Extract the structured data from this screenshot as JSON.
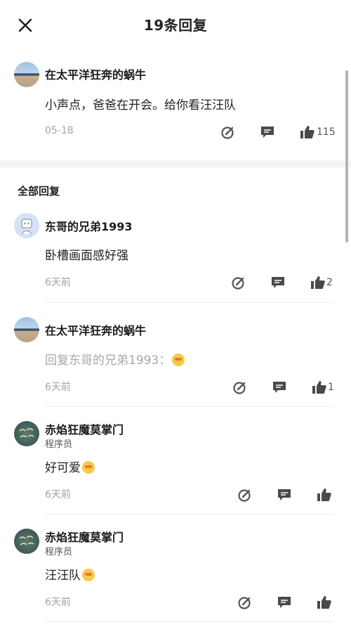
{
  "header": {
    "title": "19条回复"
  },
  "main_comment": {
    "username": "在太平洋狂奔的蜗牛",
    "content": "小声点，爸爸在开会。给你看汪汪队",
    "date": "05-18",
    "likes": "115"
  },
  "section": {
    "title": "全部回复"
  },
  "replies": [
    {
      "username": "东哥的兄弟1993",
      "role": "",
      "content": "卧槽画面感好强",
      "date": "6天前",
      "likes": "2",
      "avatar": "robot-avatar"
    },
    {
      "username": "在太平洋狂奔的蜗牛",
      "role": "",
      "content": "回复东哥的兄弟1993：",
      "date": "6天前",
      "likes": "1",
      "avatar": "beach-avatar"
    },
    {
      "username": "赤焰狂魔莫掌门",
      "role": "程序员",
      "content": "好可爱",
      "date": "6天前",
      "likes": "",
      "avatar": "chalkboard-avatar"
    },
    {
      "username": "赤焰狂魔莫掌门",
      "role": "程序员",
      "content": "汪汪队",
      "date": "6天前",
      "likes": "",
      "avatar": "chalkboard-avatar"
    }
  ],
  "icons": {
    "close": "close-icon",
    "edit": "edit-icon",
    "comment": "comment-icon",
    "like": "thumbs-up-icon"
  },
  "colors": {
    "text": "#222222",
    "muted": "#a3a3a3",
    "divider": "#ececec",
    "emoji": "#f7c84a"
  }
}
